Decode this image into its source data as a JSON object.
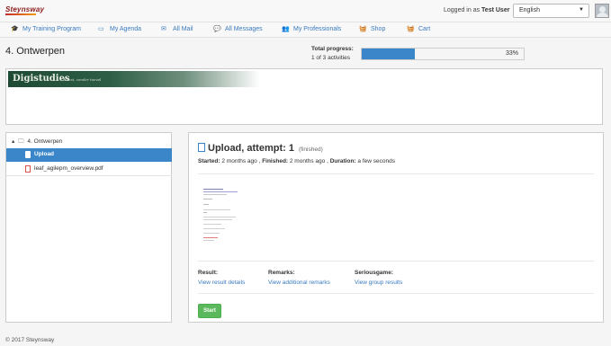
{
  "header": {
    "logo_text": "Steynsway",
    "logged_in_prefix": "Logged in as",
    "user_name": "Test User",
    "language": "English"
  },
  "nav": {
    "items": [
      {
        "label": "My Training Program",
        "icon": "training-icon"
      },
      {
        "label": "My Agenda",
        "icon": "agenda-icon"
      },
      {
        "label": "All Mail",
        "icon": "mail-icon"
      },
      {
        "label": "All Messages",
        "icon": "messages-icon"
      },
      {
        "label": "My Professionals",
        "icon": "professionals-icon"
      },
      {
        "label": "Shop",
        "icon": "shop-icon"
      },
      {
        "label": "Cart",
        "icon": "cart-icon"
      }
    ]
  },
  "page": {
    "title": "4. Ontwerpen",
    "progress_label": "Total progress:",
    "progress_sub": "1 of 3 activities",
    "progress_value": 0.33,
    "progress_text": "33%"
  },
  "banner": {
    "brand": "Digistudies",
    "tagline": "kunst, zonder toeval"
  },
  "tree": {
    "root": "4. Ontwerpen",
    "active_item": "Upload",
    "file_item": "leaf_agilepm_overview.pdf"
  },
  "main": {
    "title": "Upload, attempt: 1",
    "status": "(finished)",
    "started_label": "Started:",
    "started_value": "2 months ago ,",
    "finished_label": "Finished:",
    "finished_value": "2 months ago ,",
    "duration_label": "Duration:",
    "duration_value": "a few seconds",
    "result_label": "Result:",
    "result_link": "View result details",
    "remarks_label": "Remarks:",
    "remarks_link": "View additional remarks",
    "seriousgame_label": "Seriousgame:",
    "seriousgame_link": "View group results",
    "start_button": "Start"
  },
  "footer": {
    "text": "© 2017 Steynsway"
  },
  "colors": {
    "accent": "#3a86c8",
    "link": "#3a7abf",
    "start_button": "#5cb85c"
  }
}
